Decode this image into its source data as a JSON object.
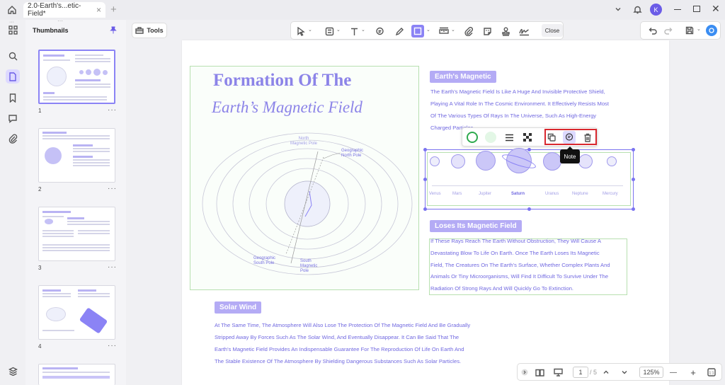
{
  "tabbar": {
    "tab_title": "2.0-Earth's...etic-Field*",
    "tab_close": "×",
    "new_tab": "+",
    "avatar_letter": "K"
  },
  "sidebar": {
    "title": "Thumbnails",
    "pages": [
      {
        "num": "1",
        "more": "···"
      },
      {
        "num": "2",
        "more": "···"
      },
      {
        "num": "3",
        "more": "···"
      },
      {
        "num": "4",
        "more": "···"
      }
    ]
  },
  "toolbar": {
    "tools_label": "Tools",
    "close_label": "Close"
  },
  "document": {
    "title_line1": "Formation Of The",
    "title_line2": "Earth’s Magnetic Field",
    "diagram": {
      "north_magnetic": "North\nMagnetic Pole",
      "geo_north": "Geographic\nNorth Pole",
      "geo_south": "Geographic\nSouth Pole",
      "south_magnetic": "South\nMagnetic\nPole"
    },
    "section1": {
      "heading": "Earth's Magnetic",
      "lines": [
        "The Earth's Magnetic Field Is Like A Huge And Invisible Protective Shield,",
        "Playing A Vital Role In The Cosmic Environment. It Effectively Resists Most",
        "Of The Various Types Of Rays In The Universe, Such As High-Energy",
        "Charged Particles"
      ]
    },
    "planets": [
      "Venus",
      "Mars",
      "Jupiter",
      "Saturn",
      "Uranus",
      "Neptune",
      "Mercury"
    ],
    "section2": {
      "heading": "Loses Its Magnetic Field",
      "lines": [
        "If These Rays Reach The Earth Without Obstruction, They Will Cause A",
        "Devastating Blow To Life On Earth. Once The Earth Loses Its Magnetic",
        "Field, The Creatures On The Earth's Surface, Whether Complex Plants And",
        "Animals Or Tiny Microorganisms, Will Find It Difficult To Survive Under The",
        "Radiation Of Strong Rays And Will Quickly Go To Extinction."
      ]
    },
    "section3": {
      "heading": "Solar Wind",
      "lines": [
        "At The Same Time, The Atmosphere Will Also Lose The Protection Of The Magnetic Field And Be Gradually",
        "Stripped Away By Forces Such As The Solar Wind, And Eventually Disappear. It Can Be Said That The",
        "Earth's Magnetic Field Provides An Indispensable Guarantee For The Reproduction Of Life On Earth And",
        "The Stable Existence Of The Atmosphere By Shielding Dangerous Substances Such As Solar Particles."
      ]
    }
  },
  "context_menu": {
    "tooltip": "Note"
  },
  "bottombar": {
    "current_page": "1",
    "total_pages": "/ 5",
    "zoom": "125%",
    "minus": "—",
    "plus": "+"
  },
  "colors": {
    "accent": "#8b83f5",
    "highlight_border": "#d9272e",
    "text_purple": "#7068e0"
  }
}
